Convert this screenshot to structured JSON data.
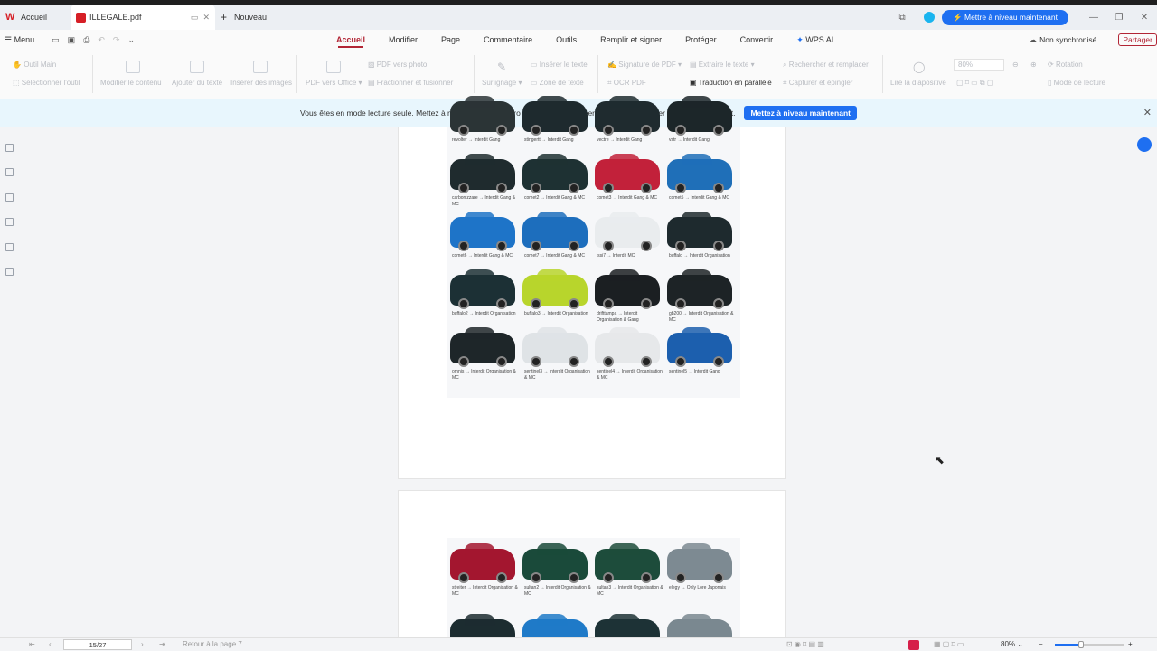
{
  "tabs": {
    "home": "Accueil",
    "file": "ILLEGALE.pdf",
    "new": "Nouveau"
  },
  "upgrade_button": "Mettre à niveau maintenant",
  "menu_label": "Menu",
  "ribbon_tabs": [
    "Accueil",
    "Modifier",
    "Page",
    "Commentaire",
    "Outils",
    "Remplir et signer",
    "Protéger",
    "Convertir",
    "WPS AI"
  ],
  "sync_status": "Non synchronisé",
  "share_button": "Partager",
  "toolbar": {
    "hand_tool": "Outil Main",
    "select_tool": "Sélectionner l'outil",
    "edit_content": "Modifier le contenu",
    "add_text": "Ajouter du texte",
    "insert_images": "Insérer des images",
    "pdf_to_office": "PDF vers Office",
    "pdf_to_photo": "PDF vers photo",
    "split_merge": "Fractionner et fusionner",
    "underline": "Surlignage",
    "insert_text": "Insérer le texte",
    "text_zone": "Zone de texte",
    "pdf_signature": "Signature de PDF",
    "ocr": "OCR PDF",
    "extract_text": "Extraire le texte",
    "translate": "Traduction en parallèle",
    "search_replace": "Rechercher et remplacer",
    "capture_pin": "Capturer et épingler",
    "read_slide": "Lire la diapositive",
    "zoom": "80%",
    "rotation": "Rotation",
    "reading_mode": "Mode de lecture"
  },
  "banner": {
    "text": "Vous êtes en mode lecture seule. Mettez à niveau vers WPS Pro et WPS AI pour créer, modifier et partager plus intelligemment.",
    "button": "Mettez à niveau maintenant"
  },
  "page1_cars": [
    {
      "label": "revolter → Interdit Gang",
      "color": "#2b3436"
    },
    {
      "label": "stingertt → Interdit Gang",
      "color": "#1e2a2e"
    },
    {
      "label": "vectre → Interdit Gang",
      "color": "#1f2b2f"
    },
    {
      "label": "vstr → Interdit Gang",
      "color": "#1c2629"
    },
    {
      "label": "carbonizzare → Interdit Gang & MC",
      "color": "#1f2b2e"
    },
    {
      "label": "comet2 → Interdit Gang & MC",
      "color": "#1e3133"
    },
    {
      "label": "comet3 → Interdit Gang & MC",
      "color": "#c2213a"
    },
    {
      "label": "comet5 → Interdit Gang & MC",
      "color": "#1f6fb8"
    },
    {
      "label": "comet6 → Interdit Gang & MC",
      "color": "#1e74c8"
    },
    {
      "label": "comet7 → Interdit Gang & MC",
      "color": "#1d6ebd"
    },
    {
      "label": "issi7 → Interdit MC",
      "color": "#e9ecee"
    },
    {
      "label": "buffalo → Interdit Organisation",
      "color": "#1e2a2e"
    },
    {
      "label": "buffalo2 → Interdit Organisation",
      "color": "#1c3035"
    },
    {
      "label": "buffalo3 → Interdit Organisation",
      "color": "#b8d52c"
    },
    {
      "label": "drifttampa → Interdit Organisation & Gang",
      "color": "#1b1f22"
    },
    {
      "label": "gb200 → Interdit Organisation & MC",
      "color": "#1d2326"
    },
    {
      "label": "omnis → Interdit Organisation & MC",
      "color": "#1e2629"
    },
    {
      "label": "sentinel3 → Interdit Organisation & MC",
      "color": "#dfe3e6"
    },
    {
      "label": "sentinel4 → Interdit Organisation & MC",
      "color": "#e6e8ea"
    },
    {
      "label": "sentinel5 → Interdit Gang",
      "color": "#1c5fae"
    }
  ],
  "page2_cars": [
    {
      "label": "streiter → Interdit Organisation & MC",
      "color": "#a3162f"
    },
    {
      "label": "sultan2 → Interdit Organisation & MC",
      "color": "#1a4a3a"
    },
    {
      "label": "sultan3 → Interdit Organisation & MC",
      "color": "#1d4c3b"
    },
    {
      "label": "elegy → Only Lore Japonais",
      "color": "#7d8a92"
    },
    {
      "label": "",
      "color": "#1c2c30"
    },
    {
      "label": "",
      "color": "#1f7ac8"
    },
    {
      "label": "",
      "color": "#1d3236"
    },
    {
      "label": "",
      "color": "#7a8890"
    }
  ],
  "status": {
    "page_indicator": "15/27",
    "back": "Retour à la page 7",
    "zoom": "80%"
  }
}
